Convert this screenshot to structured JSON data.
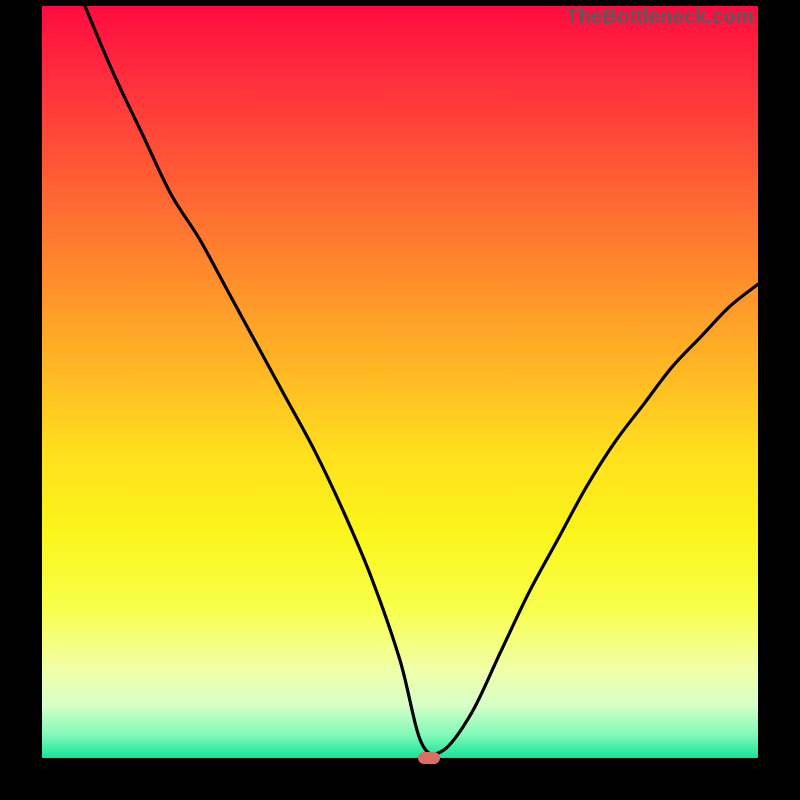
{
  "watermark": "TheBottleneck.com",
  "chart_data": {
    "type": "line",
    "title": "",
    "xlabel": "",
    "ylabel": "",
    "xlim": [
      0,
      100
    ],
    "ylim": [
      0,
      100
    ],
    "grid": false,
    "legend": false,
    "annotations": [
      {
        "name": "marker",
        "x": 54,
        "y": 0,
        "color": "#da6e63"
      }
    ],
    "series": [
      {
        "name": "bottleneck-curve",
        "color": "#000000",
        "x": [
          6,
          10,
          14,
          18,
          22,
          26,
          30,
          34,
          38,
          42,
          46,
          50,
          53,
          56,
          60,
          64,
          68,
          72,
          76,
          80,
          84,
          88,
          92,
          96,
          100
        ],
        "values": [
          100,
          91,
          83,
          75,
          69,
          62,
          55,
          48,
          41,
          33,
          24,
          13,
          2,
          1,
          6,
          14,
          22,
          29,
          36,
          42,
          47,
          52,
          56,
          60,
          63
        ]
      }
    ]
  }
}
